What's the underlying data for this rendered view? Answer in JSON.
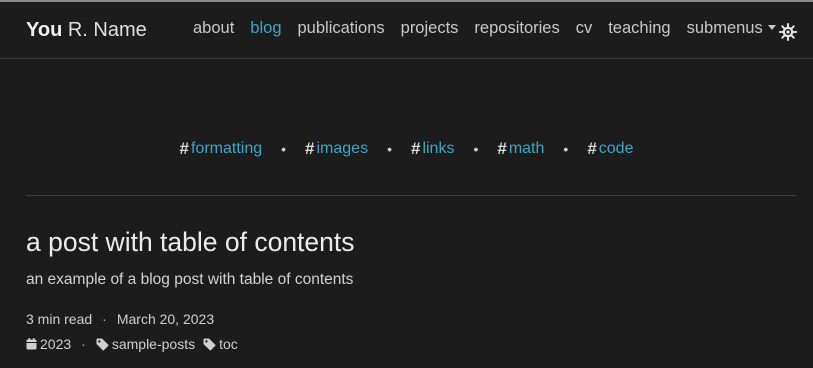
{
  "brand": {
    "first": "You",
    "rest": " R. Name"
  },
  "nav": {
    "items": [
      {
        "label": "about"
      },
      {
        "label": "blog"
      },
      {
        "label": "publications"
      },
      {
        "label": "projects"
      },
      {
        "label": "repositories"
      },
      {
        "label": "cv"
      },
      {
        "label": "teaching"
      },
      {
        "label": "submenus"
      }
    ],
    "active_label": "blog",
    "theme_toggle_icon": "sun-icon"
  },
  "tag_bar": {
    "hash_symbol": "#",
    "separator": "•",
    "tags": [
      "formatting",
      "images",
      "links",
      "math",
      "code"
    ]
  },
  "post": {
    "title": "a post with table of contents",
    "description": "an example of a blog post with table of contents",
    "read_time": "3 min read",
    "meta_separator": "·",
    "date": "March 20, 2023",
    "year": "2023",
    "tags": [
      "sample-posts",
      "toc"
    ]
  },
  "colors": {
    "background": "#1c1c1d",
    "accent": "#3ea6c6",
    "text": "#c8c8c8"
  }
}
